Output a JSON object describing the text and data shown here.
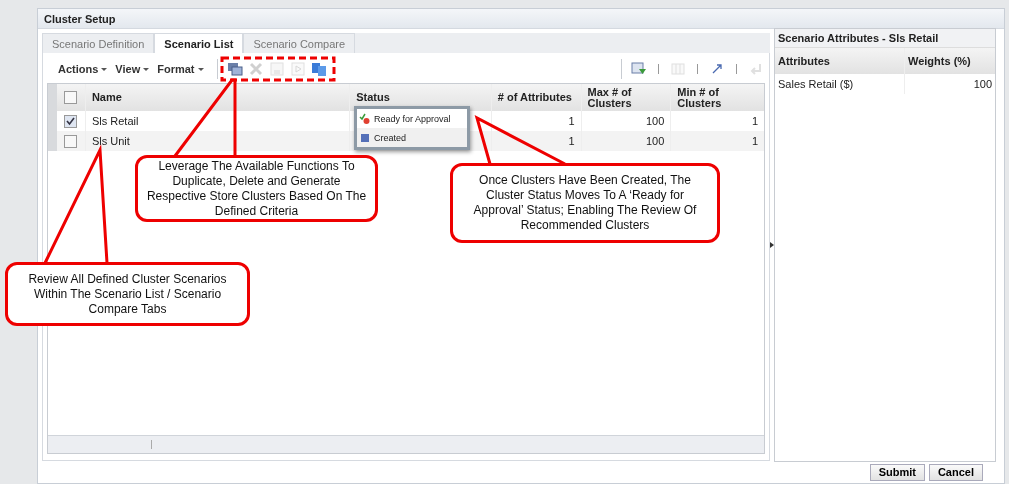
{
  "window": {
    "title": "Cluster Setup"
  },
  "tabs": [
    {
      "label": "Scenario Definition",
      "selected": false
    },
    {
      "label": "Scenario List",
      "selected": true
    },
    {
      "label": "Scenario Compare",
      "selected": false
    }
  ],
  "toolbar": {
    "menus": [
      "Actions",
      "View",
      "Format"
    ],
    "actions": [
      {
        "kind": "duplicate",
        "disabled": false
      },
      {
        "kind": "delete",
        "disabled": true
      },
      {
        "kind": "save",
        "disabled": true
      },
      {
        "kind": "run",
        "disabled": true
      },
      {
        "kind": "generate",
        "disabled": false
      }
    ],
    "view_actions": [
      {
        "kind": "filter",
        "disabled": false
      },
      {
        "kind": "columns",
        "disabled": true
      },
      {
        "kind": "detach",
        "disabled": false
      },
      {
        "kind": "wrap",
        "disabled": true
      }
    ]
  },
  "table": {
    "header_checked": false,
    "columns": [
      "Name",
      "Status",
      "# of Attributes",
      "Max # of Clusters",
      "Min # of Clusters"
    ],
    "rows": [
      {
        "checked": true,
        "name": "Sls Retail",
        "attributes": "1",
        "max_clusters": "100",
        "min_clusters": "1"
      },
      {
        "checked": false,
        "name": "Sls Unit",
        "attributes": "1",
        "max_clusters": "100",
        "min_clusters": "1"
      }
    ],
    "status_popup": [
      {
        "kind": "ready",
        "label": "Ready for Approval"
      },
      {
        "kind": "created",
        "label": "Created"
      }
    ]
  },
  "attributes_panel": {
    "title": "Scenario Attributes - Sls Retail",
    "columns": [
      "Attributes",
      "Weights (%)"
    ],
    "rows": [
      {
        "attribute": "Sales Retail ($)",
        "weight": "100"
      }
    ]
  },
  "buttons": [
    "Submit",
    "Cancel"
  ],
  "callouts": [
    {
      "text": "Leverage The Available Functions To Duplicate, Delete and Generate Respective Store Clusters Based On The Defined Criteria"
    },
    {
      "text": "Once Clusters Have Been Created, The Cluster Status Moves To A ‘Ready for Approval’ Status; Enabling The Review Of Recommended Clusters"
    },
    {
      "text": "Review All Defined Cluster Scenarios Within The Scenario List / Scenario Compare Tabs"
    }
  ]
}
